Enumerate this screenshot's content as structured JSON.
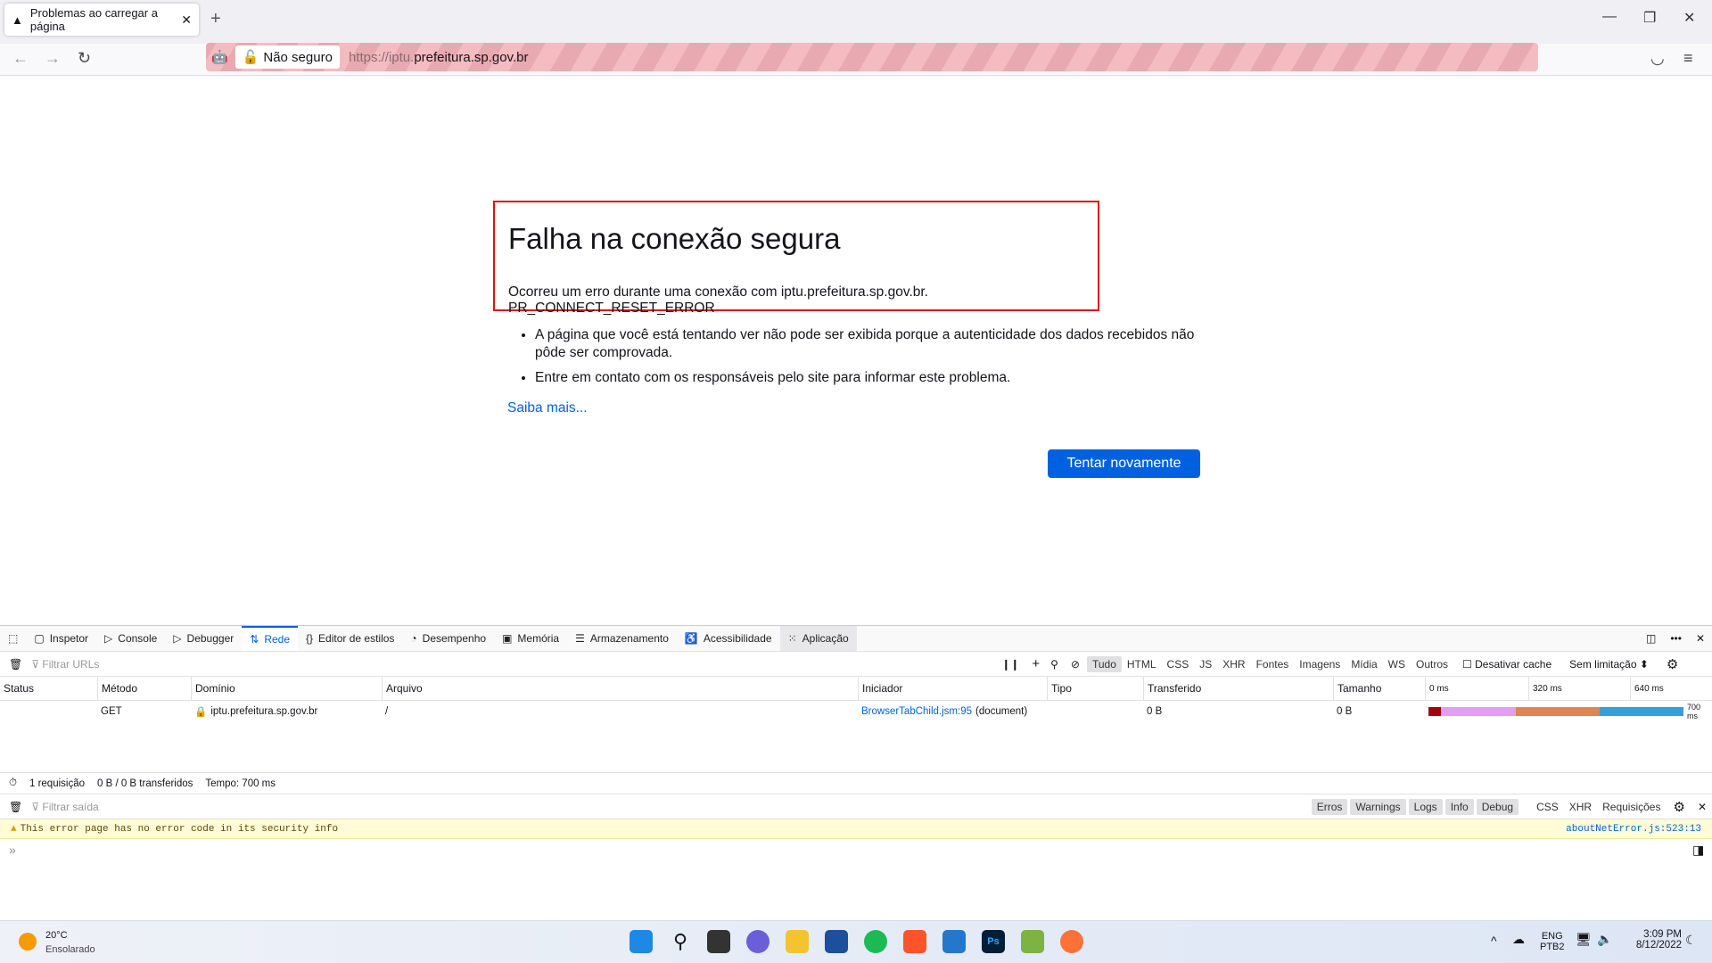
{
  "browser": {
    "tab_title": "Problemas ao carregar a página",
    "not_secure": "Não seguro",
    "url_prefix": "https://iptu.",
    "url_domain": "prefeitura.sp.gov.br"
  },
  "error": {
    "title": "Falha na conexão segura",
    "message": "Ocorreu um erro durante uma conexão com iptu.prefeitura.sp.gov.br. PR_CONNECT_RESET_ERROR",
    "bullets": [
      "A página que você está tentando ver não pode ser exibida porque a autenticidade dos dados recebidos não pôde ser comprovada.",
      "Entre em contato com os responsáveis pelo site para informar este problema."
    ],
    "learn_more": "Saiba mais...",
    "retry": "Tentar novamente"
  },
  "devtools": {
    "tabs": [
      "Inspetor",
      "Console",
      "Debugger",
      "Rede",
      "Editor de estilos",
      "Desempenho",
      "Memória",
      "Armazenamento",
      "Acessibilidade",
      "Aplicação"
    ],
    "active_tab": "Rede",
    "filter_placeholder": "Filtrar URLs",
    "type_filters": [
      "Tudo",
      "HTML",
      "CSS",
      "JS",
      "XHR",
      "Fontes",
      "Imagens",
      "Mídia",
      "WS",
      "Outros"
    ],
    "disable_cache": "Desativar cache",
    "throttle": "Sem limitação",
    "columns": [
      "Status",
      "Método",
      "Domínio",
      "Arquivo",
      "Iniciador",
      "Tipo",
      "Transferido",
      "Tamanho"
    ],
    "timeline_ticks": [
      "0 ms",
      "320 ms",
      "640 ms"
    ],
    "rows": [
      {
        "status": "",
        "method": "GET",
        "domain": "iptu.prefeitura.sp.gov.br",
        "file": "/",
        "initiator_link": "BrowserTabChild.jsm:95",
        "initiator_type": "(document)",
        "type": "",
        "transferred": "0 B",
        "size": "0 B",
        "timing": "700 ms"
      }
    ],
    "timing_colors": [
      "#a50012",
      "#e69bf7",
      "#e08450",
      "#33a0d8"
    ],
    "summary": {
      "requests": "1 requisição",
      "transferred": "0 B / 0 B transferidos",
      "time": "Tempo: 700 ms"
    },
    "console": {
      "filter_placeholder": "Filtrar saída",
      "levels": [
        "Erros",
        "Warnings",
        "Logs",
        "Info",
        "Debug"
      ],
      "extra": [
        "CSS",
        "XHR",
        "Requisições"
      ],
      "warning": "This error page has no error code in its security info",
      "warning_source": "aboutNetError.js:523:13"
    }
  },
  "taskbar": {
    "temp": "20°C",
    "weather": "Ensolarado",
    "lang1": "ENG",
    "lang2": "PTB2",
    "time": "3:09 PM",
    "date": "8/12/2022"
  }
}
